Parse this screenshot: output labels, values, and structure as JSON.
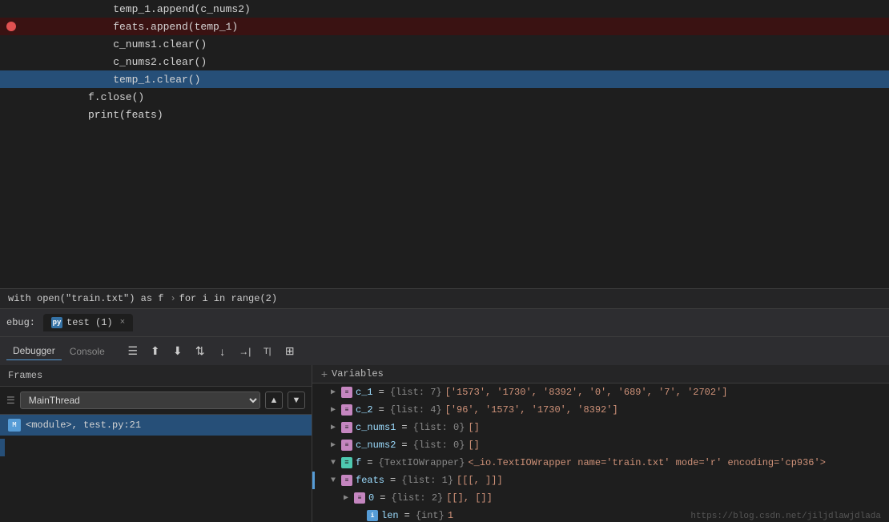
{
  "editor": {
    "lines": [
      {
        "id": "line1",
        "text": "    temp_1.append(c_nums2)",
        "indent": 4,
        "highlight": "none",
        "breakpoint": false
      },
      {
        "id": "line2",
        "text": "    feats.append(temp_1)",
        "indent": 4,
        "highlight": "red",
        "breakpoint": true
      },
      {
        "id": "line3",
        "text": "    c_nums1.clear()",
        "indent": 4,
        "highlight": "none",
        "breakpoint": false
      },
      {
        "id": "line4",
        "text": "    c_nums2.clear()",
        "indent": 4,
        "highlight": "none",
        "breakpoint": false
      },
      {
        "id": "line5",
        "text": "    temp_1.clear()",
        "indent": 4,
        "highlight": "blue",
        "breakpoint": false
      },
      {
        "id": "line6",
        "text": "f.close()",
        "indent": 0,
        "highlight": "none",
        "breakpoint": false
      },
      {
        "id": "line7",
        "text": "print(feats)",
        "indent": 0,
        "highlight": "none",
        "breakpoint": false
      }
    ]
  },
  "breadcrumb": {
    "parts": [
      "with open(\"train.txt\") as f",
      "for i in range(2)"
    ]
  },
  "debug_tabbar": {
    "label": "ebug:",
    "tab_label": "test (1)",
    "close": "×"
  },
  "toolbar": {
    "tab_debugger": "Debugger",
    "tab_console": "Console",
    "btn_pause": "≡",
    "btn_step_over": "↑",
    "btn_step_into": "↓",
    "btn_step_out_into": "↕",
    "btn_step_out": "↓",
    "btn_run_to": "→",
    "btn_eval": "⌨",
    "btn_grid": "⊞"
  },
  "frames_panel": {
    "header": "Frames",
    "thread_name": "MainThread",
    "frame_item": "<module>, test.py:21"
  },
  "variables_panel": {
    "header": "Variables",
    "vars": [
      {
        "name": "c_1",
        "type": "{list: 7}",
        "value": "['1573', '1730', '8392', '0', '689', '7', '2702']",
        "expanded": false,
        "indent": 1
      },
      {
        "name": "c_2",
        "type": "{list: 4}",
        "value": "['96', '1573', '1730', '8392']",
        "expanded": false,
        "indent": 1
      },
      {
        "name": "c_nums1",
        "type": "{list: 0}",
        "value": "[]",
        "expanded": false,
        "indent": 1
      },
      {
        "name": "c_nums2",
        "type": "{list: 0}",
        "value": "[]",
        "expanded": false,
        "indent": 1
      },
      {
        "name": "f",
        "type": "{TextIOWrapper}",
        "value": "<_io.TextIOWrapper name='train.txt' mode='r' encoding='cp936'>",
        "expanded": true,
        "indent": 1
      },
      {
        "name": "feats",
        "type": "{list: 1}",
        "value": "[[[, ]]]",
        "expanded": true,
        "indent": 1
      },
      {
        "name": "0",
        "type": "{list: 2}",
        "value": "[[], []]",
        "expanded": false,
        "indent": 2
      },
      {
        "name": "len",
        "type": "{int}",
        "value": "1",
        "expanded": false,
        "indent": 3
      }
    ]
  },
  "watermark": "https://blog.csdn.net/jiljdlawjdlada"
}
